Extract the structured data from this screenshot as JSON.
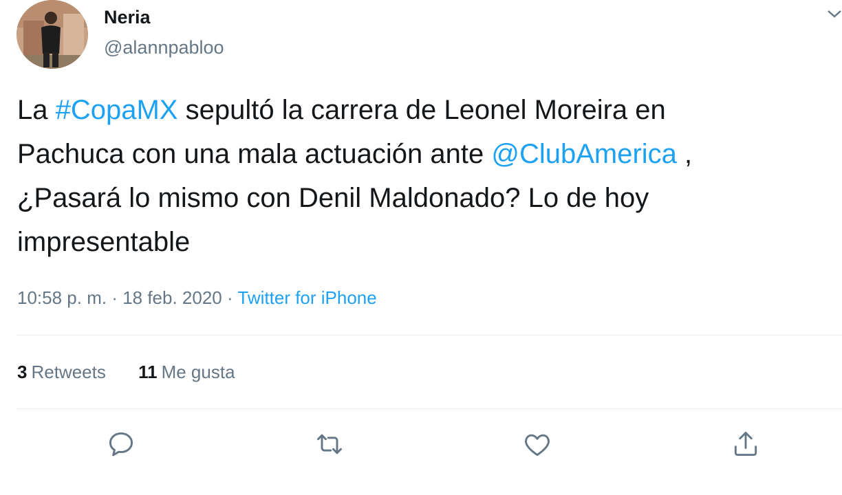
{
  "user": {
    "display_name": "Neria",
    "handle": "@alannpabloo"
  },
  "tweet": {
    "line1": {
      "pre": "La ",
      "hashtag": "#CopaMX",
      "post": " sepultó la carrera de Leonel Moreira en"
    },
    "line2": {
      "pre": "Pachuca con una mala actuación ante ",
      "mention": "@ClubAmerica",
      "post": " ,"
    },
    "line3": "¿Pasará lo mismo con Denil Maldonado? Lo de hoy",
    "line4": "impresentable"
  },
  "meta": {
    "time": "10:58 p. m.",
    "sep1": " · ",
    "date": "18 feb. 2020",
    "sep2": " · ",
    "source": "Twitter for iPhone"
  },
  "stats": {
    "retweets_count": "3",
    "retweets_label": "Retweets",
    "likes_count": "11",
    "likes_label": "Me gusta"
  },
  "actions": {
    "reply": "reply-icon",
    "retweet": "retweet-icon",
    "like": "heart-icon",
    "share": "share-icon"
  },
  "colors": {
    "link": "#1da1f2",
    "muted": "#657786",
    "text": "#14171a",
    "divider": "#e6ecf0"
  }
}
